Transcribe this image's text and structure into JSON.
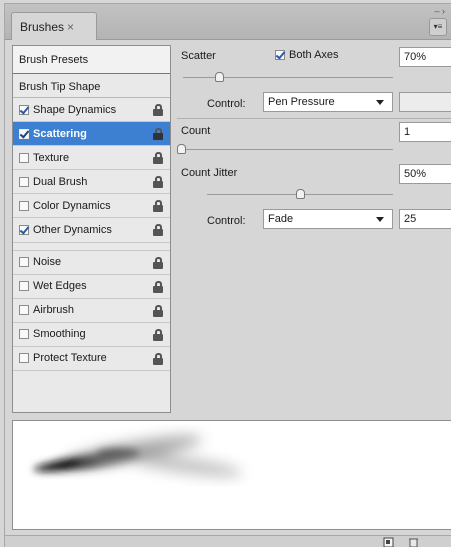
{
  "panel": {
    "tab_title": "Brushes",
    "tab_close": "×"
  },
  "left": {
    "presets": "Brush Presets",
    "tip_shape": "Brush Tip Shape",
    "items": [
      {
        "label": "Shape Dynamics",
        "checked": true
      },
      {
        "label": "Scattering",
        "checked": true,
        "selected": true
      },
      {
        "label": "Texture",
        "checked": false
      },
      {
        "label": "Dual Brush",
        "checked": false
      },
      {
        "label": "Color Dynamics",
        "checked": false
      },
      {
        "label": "Other Dynamics",
        "checked": true
      },
      {
        "label": "Noise",
        "checked": false
      },
      {
        "label": "Wet Edges",
        "checked": false
      },
      {
        "label": "Airbrush",
        "checked": false
      },
      {
        "label": "Smoothing",
        "checked": false
      },
      {
        "label": "Protect Texture",
        "checked": false
      }
    ]
  },
  "scatter": {
    "label": "Scatter",
    "both_axes_label": "Both Axes",
    "both_axes_checked": true,
    "value": "70%",
    "slider_fraction": 0.17,
    "control_label": "Control:",
    "control_value": "Pen Pressure"
  },
  "count": {
    "label": "Count",
    "value": "1",
    "slider_fraction": 0.0
  },
  "count_jitter": {
    "label": "Count Jitter",
    "value": "50%",
    "slider_fraction": 0.5,
    "control_label": "Control:",
    "control_value": "Fade",
    "fade_steps": "25"
  },
  "colors": {
    "selection": "#3d7fd1"
  }
}
